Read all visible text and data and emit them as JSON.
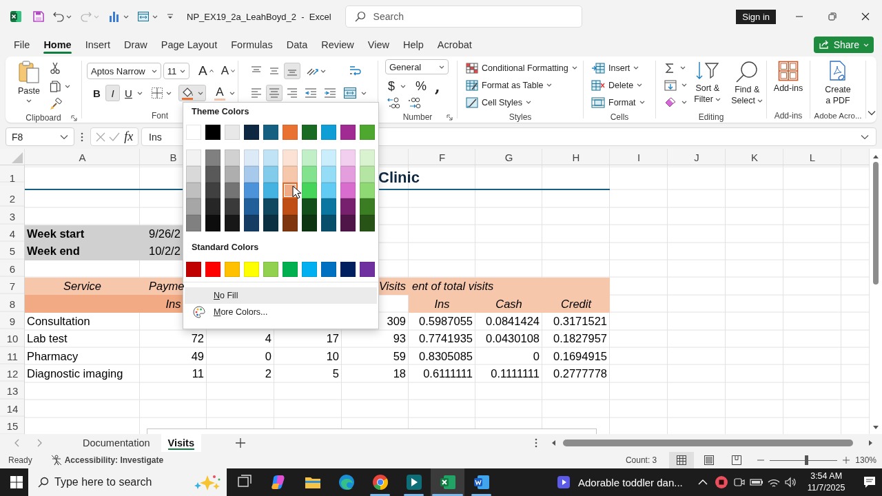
{
  "title_bar": {
    "title": "NP_EX19_2a_LeahBoyd_2  -  Excel",
    "search": {
      "placeholder": "Search"
    },
    "sign_in": "Sign in"
  },
  "menu_tabs": [
    {
      "label": "File",
      "selected": false
    },
    {
      "label": "Home",
      "selected": true
    },
    {
      "label": "Insert",
      "selected": false
    },
    {
      "label": "Draw",
      "selected": false
    },
    {
      "label": "Page Layout",
      "selected": false
    },
    {
      "label": "Formulas",
      "selected": false
    },
    {
      "label": "Data",
      "selected": false
    },
    {
      "label": "Review",
      "selected": false
    },
    {
      "label": "View",
      "selected": false
    },
    {
      "label": "Help",
      "selected": false
    },
    {
      "label": "Acrobat",
      "selected": false
    }
  ],
  "share": "Share",
  "ribbon": {
    "clipboard": {
      "paste": "Paste",
      "label": "Clipboard"
    },
    "font": {
      "name": "Aptos Narrow",
      "size": "11",
      "grow": "A",
      "shrink": "A",
      "format_buttons": [
        {
          "label": "B",
          "kind": "bold",
          "on": false
        },
        {
          "label": "I",
          "kind": "italic",
          "on": true
        },
        {
          "label": "U",
          "kind": "underline",
          "on": false
        }
      ],
      "fill_color": {
        "pressed": true
      },
      "font_color": "A",
      "label": "Font"
    },
    "alignment": {
      "vertical": [
        {
          "kind": "top",
          "on": false
        },
        {
          "kind": "middle",
          "on": false
        },
        {
          "kind": "bottom",
          "on": true
        }
      ],
      "horizontal": [
        {
          "kind": "left",
          "on": false
        },
        {
          "kind": "center",
          "on": true
        },
        {
          "kind": "right",
          "on": false
        }
      ]
    },
    "number": {
      "format": "General",
      "currency": "$",
      "percent": "%",
      "comma": ",",
      "label": "Number"
    },
    "styles": {
      "items": [
        {
          "label": "Conditional Formatting",
          "kind": "conditional"
        },
        {
          "label": "Format as Table",
          "kind": "table"
        },
        {
          "label": "Cell Styles",
          "kind": "cell-styles"
        }
      ],
      "label": "Styles"
    },
    "cells": {
      "items": [
        {
          "label": "Insert",
          "kind": "insert"
        },
        {
          "label": "Delete",
          "kind": "delete"
        },
        {
          "label": "Format",
          "kind": "format"
        }
      ],
      "label": "Cells"
    },
    "editing": {
      "sort": "Sort & Filter",
      "find": "Find & Select",
      "label": "Editing"
    },
    "addins": {
      "button": "Add-ins",
      "label": "Add-ins"
    },
    "adobe": {
      "button": "Create a PDF",
      "label": "Adobe Acro..."
    }
  },
  "formula_bar": {
    "name_box": "F8",
    "function_button": "fx",
    "content": "Ins"
  },
  "sheet": {
    "columns": [
      "A",
      "B",
      null,
      null,
      null,
      "F",
      "G",
      "H",
      "I",
      "J",
      "K",
      "L"
    ],
    "rows": [
      {
        "number": "1",
        "kind": "title",
        "cells": [
          null,
          null,
          null,
          null,
          "Clinic",
          null,
          null,
          null
        ]
      },
      {
        "number": "2",
        "kind": "blank"
      },
      {
        "number": "3",
        "kind": "blank"
      },
      {
        "number": "4",
        "kind": "date",
        "cells": [
          "Week start",
          "9/26/2",
          null,
          null,
          null,
          null,
          null,
          null
        ]
      },
      {
        "number": "5",
        "kind": "date",
        "cells": [
          "Week end",
          "10/2/2",
          null,
          null,
          null,
          null,
          null,
          null
        ]
      },
      {
        "number": "6",
        "kind": "blank"
      },
      {
        "number": "7",
        "kind": "header",
        "cells": [
          "Service",
          "Payme",
          null,
          null,
          "Visits",
          "ent of total visits",
          null,
          null
        ]
      },
      {
        "number": "8",
        "kind": "subheader",
        "cells": [
          null,
          "Ins",
          null,
          null,
          null,
          "Ins",
          "Cash",
          "Credit"
        ]
      },
      {
        "number": "9",
        "kind": "data",
        "cells": [
          "Consultation",
          null,
          null,
          null,
          "309",
          "0.5987055",
          "0.0841424",
          "0.3171521"
        ]
      },
      {
        "number": "10",
        "kind": "data",
        "cells": [
          "Lab test",
          "72",
          "4",
          "17",
          "93",
          "0.7741935",
          "0.0430108",
          "0.1827957"
        ]
      },
      {
        "number": "11",
        "kind": "data",
        "cells": [
          "Pharmacy",
          "49",
          "0",
          "10",
          "59",
          "0.8305085",
          "0",
          "0.1694915"
        ]
      },
      {
        "number": "12",
        "kind": "data",
        "cells": [
          "Diagnostic imaging",
          "11",
          "2",
          "5",
          "18",
          "0.6111111",
          "0.1111111",
          "0.2777778"
        ]
      },
      {
        "number": "13",
        "kind": "blank"
      },
      {
        "number": "14",
        "kind": "blank"
      },
      {
        "number": "15",
        "kind": "blank"
      }
    ]
  },
  "color_picker": {
    "theme_title": "Theme Colors",
    "theme_colors": [
      {
        "color": "#ffffff",
        "hovered": false
      },
      {
        "color": "#000000",
        "hovered": false
      },
      {
        "color": "#e8e8e8",
        "hovered": false
      },
      {
        "color": "#0e2841",
        "hovered": false
      },
      {
        "color": "#156082",
        "hovered": false
      },
      {
        "color": "#e97132",
        "hovered": false
      },
      {
        "color": "#196b24",
        "hovered": false
      },
      {
        "color": "#0f9ed5",
        "hovered": false
      },
      {
        "color": "#a02b93",
        "hovered": false
      },
      {
        "color": "#4ea72e",
        "hovered": false
      }
    ],
    "shades": [
      [
        {
          "color": "#f2f2f2",
          "hovered": false
        },
        {
          "color": "#808080",
          "hovered": false
        },
        {
          "color": "#d1d1d1",
          "hovered": false
        },
        {
          "color": "#dceaf7",
          "hovered": false
        },
        {
          "color": "#c0e4f5",
          "hovered": false
        },
        {
          "color": "#fbe2d5",
          "hovered": false
        },
        {
          "color": "#c1f0c8",
          "hovered": false
        },
        {
          "color": "#caeefb",
          "hovered": false
        },
        {
          "color": "#f2cfee",
          "hovered": false
        },
        {
          "color": "#d9f2d0",
          "hovered": false
        }
      ],
      [
        {
          "color": "#d9d9d9",
          "hovered": false
        },
        {
          "color": "#595959",
          "hovered": false
        },
        {
          "color": "#aeaeae",
          "hovered": false
        },
        {
          "color": "#a6c9ec",
          "hovered": false
        },
        {
          "color": "#83cbeb",
          "hovered": false
        },
        {
          "color": "#f7c7ac",
          "hovered": false
        },
        {
          "color": "#83e28e",
          "hovered": false
        },
        {
          "color": "#95dcf7",
          "hovered": false
        },
        {
          "color": "#e59edd",
          "hovered": false
        },
        {
          "color": "#b4e5a2",
          "hovered": false
        }
      ],
      [
        {
          "color": "#bfbfbf",
          "hovered": false
        },
        {
          "color": "#404040",
          "hovered": false
        },
        {
          "color": "#747474",
          "hovered": false
        },
        {
          "color": "#4d93d9",
          "hovered": false
        },
        {
          "color": "#44b3e1",
          "hovered": false
        },
        {
          "color": "#f2aa84",
          "hovered": true
        },
        {
          "color": "#47d45a",
          "hovered": false
        },
        {
          "color": "#61cbf3",
          "hovered": false
        },
        {
          "color": "#d86dcd",
          "hovered": false
        },
        {
          "color": "#8ed973",
          "hovered": false
        }
      ],
      [
        {
          "color": "#a6a6a6",
          "hovered": false
        },
        {
          "color": "#262626",
          "hovered": false
        },
        {
          "color": "#3a3a3a",
          "hovered": false
        },
        {
          "color": "#215f9a",
          "hovered": false
        },
        {
          "color": "#104862",
          "hovered": false
        },
        {
          "color": "#c04f15",
          "hovered": false
        },
        {
          "color": "#124f1a",
          "hovered": false
        },
        {
          "color": "#0b76a0",
          "hovered": false
        },
        {
          "color": "#77206d",
          "hovered": false
        },
        {
          "color": "#3a7d22",
          "hovered": false
        }
      ],
      [
        {
          "color": "#808080",
          "hovered": false
        },
        {
          "color": "#0d0d0d",
          "hovered": false
        },
        {
          "color": "#171717",
          "hovered": false
        },
        {
          "color": "#153d63",
          "hovered": false
        },
        {
          "color": "#0b3041",
          "hovered": false
        },
        {
          "color": "#7f350e",
          "hovered": false
        },
        {
          "color": "#0d3512",
          "hovered": false
        },
        {
          "color": "#074f6a",
          "hovered": false
        },
        {
          "color": "#4f1548",
          "hovered": false
        },
        {
          "color": "#275317",
          "hovered": false
        }
      ]
    ],
    "standard_title": "Standard Colors",
    "standard_colors": [
      {
        "color": "#c00000",
        "hovered": false
      },
      {
        "color": "#ff0000",
        "hovered": false
      },
      {
        "color": "#ffc000",
        "hovered": false
      },
      {
        "color": "#ffff00",
        "hovered": false
      },
      {
        "color": "#92d050",
        "hovered": false
      },
      {
        "color": "#00b050",
        "hovered": false
      },
      {
        "color": "#00b0f0",
        "hovered": false
      },
      {
        "color": "#0070c0",
        "hovered": false
      },
      {
        "color": "#002060",
        "hovered": false
      },
      {
        "color": "#7030a0",
        "hovered": false
      }
    ],
    "options": [
      {
        "label": "No Fill",
        "kind": "no-fill",
        "highlighted": true
      },
      {
        "label": "More Colors...",
        "kind": "more",
        "highlighted": false
      }
    ]
  },
  "sheet_tabs": [
    {
      "label": "Documentation",
      "selected": false
    },
    {
      "label": "Visits",
      "selected": true
    }
  ],
  "status_bar": {
    "mode": "Ready",
    "accessibility": "Accessibility: Investigate",
    "count": "Count: 3",
    "views": [
      {
        "kind": "normal",
        "selected": true
      },
      {
        "kind": "page-layout",
        "selected": false
      },
      {
        "kind": "page-break",
        "selected": false
      }
    ],
    "zoom": {
      "level": 0.54,
      "reading": "130%"
    }
  },
  "taskbar": {
    "search": {
      "placeholder": "Type here to search"
    },
    "apps": [
      {
        "kind": "task-view",
        "running": false,
        "active": false
      },
      {
        "kind": "copilot",
        "running": false,
        "active": false
      },
      {
        "kind": "explorer",
        "running": false,
        "active": false
      },
      {
        "kind": "edge",
        "running": false,
        "active": false
      },
      {
        "kind": "chrome",
        "running": true,
        "active": false
      },
      {
        "kind": "editor",
        "running": true,
        "active": false
      },
      {
        "kind": "excel",
        "running": true,
        "active": true
      },
      {
        "kind": "word",
        "running": true,
        "active": false
      }
    ],
    "media": "Adorable toddler dan...",
    "time": "3:54 AM",
    "date": "11/7/2025"
  }
}
